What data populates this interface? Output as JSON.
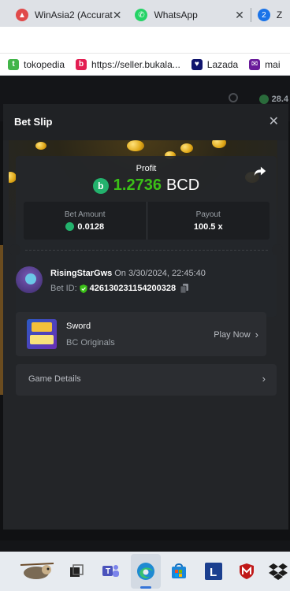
{
  "browser": {
    "tabs": [
      {
        "title": "WinAsia2 (Accurat",
        "favicon_color": "#e04a4a"
      },
      {
        "title": "WhatsApp",
        "favicon_color": "#25d366"
      },
      {
        "title": "Z",
        "favicon_color": "#1a73e8",
        "favicon_text": "2"
      }
    ],
    "bookmarks": [
      {
        "label": "tokopedia",
        "icon": "tokopedia-icon",
        "color": "#42b549"
      },
      {
        "label": "https://seller.bukala...",
        "icon": "bukalapak-icon",
        "color": "#e31e52"
      },
      {
        "label": "Lazada",
        "icon": "lazada-icon",
        "color": "#0f146d"
      },
      {
        "label": "mai",
        "icon": "mail-icon",
        "color": "#6a1b9a"
      }
    ]
  },
  "site": {
    "balance": "28.4"
  },
  "modal": {
    "title": "Bet Slip",
    "profit_label": "Profit",
    "profit_amount": "1.2736",
    "currency": "BCD",
    "bet_amount_label": "Bet Amount",
    "bet_amount": "0.0128",
    "payout_label": "Payout",
    "payout": "100.5 x",
    "username": "RisingStarGws",
    "date": "On 3/30/2024, 22:45:40",
    "bet_id_label": "Bet ID:",
    "bet_id": "426130231154200328",
    "game_name": "Sword",
    "game_provider": "BC Originals",
    "play_now": "Play Now",
    "game_details": "Game Details",
    "colors": {
      "profit": "#3bc117",
      "coin": "#23b26d",
      "modal_bg": "#232528"
    }
  },
  "taskbar": {
    "items": [
      "sloth-app-icon",
      "task-view-icon",
      "teams-icon",
      "edge-icon",
      "store-icon",
      "l-app-icon",
      "mcafee-icon",
      "dropbox-icon"
    ]
  }
}
